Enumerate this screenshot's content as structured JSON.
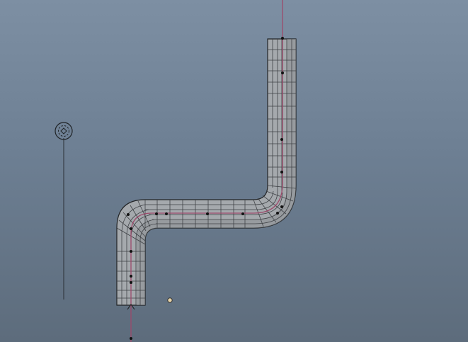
{
  "viewport": {
    "background_top": "#7d8fa3",
    "background_bottom": "#5d6c7c"
  },
  "mesh": {
    "name_icon": "bent-pipe-mesh",
    "fill_color": "#a5a9ad",
    "wire_color": "#3f4246",
    "outline_color": "#222426"
  },
  "curve": {
    "icon": "nurbs-curve",
    "color": "#9c4a6b"
  },
  "curve_points": {
    "icon": "control-point",
    "color": "#111111",
    "count": 16
  },
  "locator": {
    "icon": "dashed-circle-locator-icon",
    "color": "#1f2326"
  },
  "pivot": {
    "icon": "pivot-point-icon",
    "fill": "#e6d3a8",
    "stroke": "#333333"
  }
}
